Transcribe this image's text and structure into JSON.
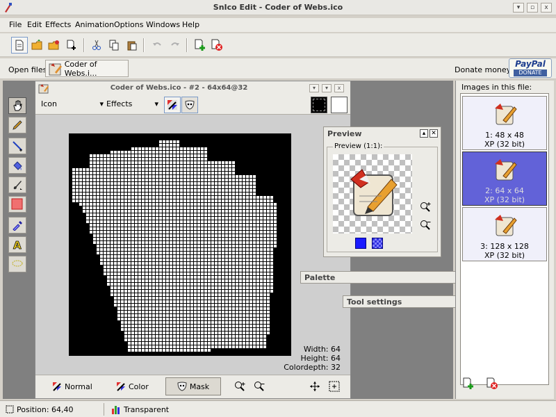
{
  "window": {
    "title": "SnIco Edit - Coder of Webs.ico",
    "controls": {
      "minimize": "▾",
      "maximize": "▫",
      "close": "x"
    }
  },
  "menu": [
    "File",
    "Edit",
    "Effects",
    "Animation",
    "Options",
    "Windows",
    "Help"
  ],
  "toolbar": {
    "icons": [
      "new-file-icon",
      "open-folder-icon",
      "open-recent-icon",
      "new-image-icon",
      "cut-icon",
      "copy-icon",
      "paste-icon",
      "undo-icon",
      "redo-icon",
      "add-image-icon",
      "delete-image-icon"
    ]
  },
  "open_files": {
    "label": "Open files:",
    "file_tab": "Coder of Webs.i...",
    "donate_label": "Donate money:",
    "paypal_top": "PayPal",
    "paypal_bottom": "DONATE"
  },
  "tools": [
    "hand-icon",
    "pencil-icon",
    "line-icon",
    "fill-bucket-icon",
    "brush-icon",
    "rectangle-icon",
    "color-picker-icon",
    "text-icon",
    "lasso-icon"
  ],
  "document": {
    "title": "Coder of Webs.ico - #2 - 64x64@32",
    "mode_select": "Icon",
    "effects_select": "Effects",
    "info": {
      "width": "Width: 64",
      "height": "Height: 64",
      "colordepth": "Colordepth: 32"
    },
    "footer": {
      "normal": "Normal",
      "color": "Color",
      "mask": "Mask"
    }
  },
  "preview_panel": {
    "title": "Preview",
    "group_label": "Preview (1:1):"
  },
  "palette_panel": {
    "title": "Palette"
  },
  "tool_settings_panel": {
    "title": "Tool settings"
  },
  "images_panel": {
    "title": "Images in this file:",
    "images": [
      {
        "size": "1: 48 x 48",
        "format": "XP (32 bit)"
      },
      {
        "size": "2: 64 x 64",
        "format": "XP (32 bit)"
      },
      {
        "size": "3: 128 x 128",
        "format": "XP (32 bit)"
      }
    ],
    "selected_index": 1
  },
  "status": {
    "position": "Position: 64,40",
    "color": "Transparent"
  },
  "colors": {
    "selection": "#6262d8",
    "workspace": "#808080",
    "chrome": "#ecebe6"
  }
}
